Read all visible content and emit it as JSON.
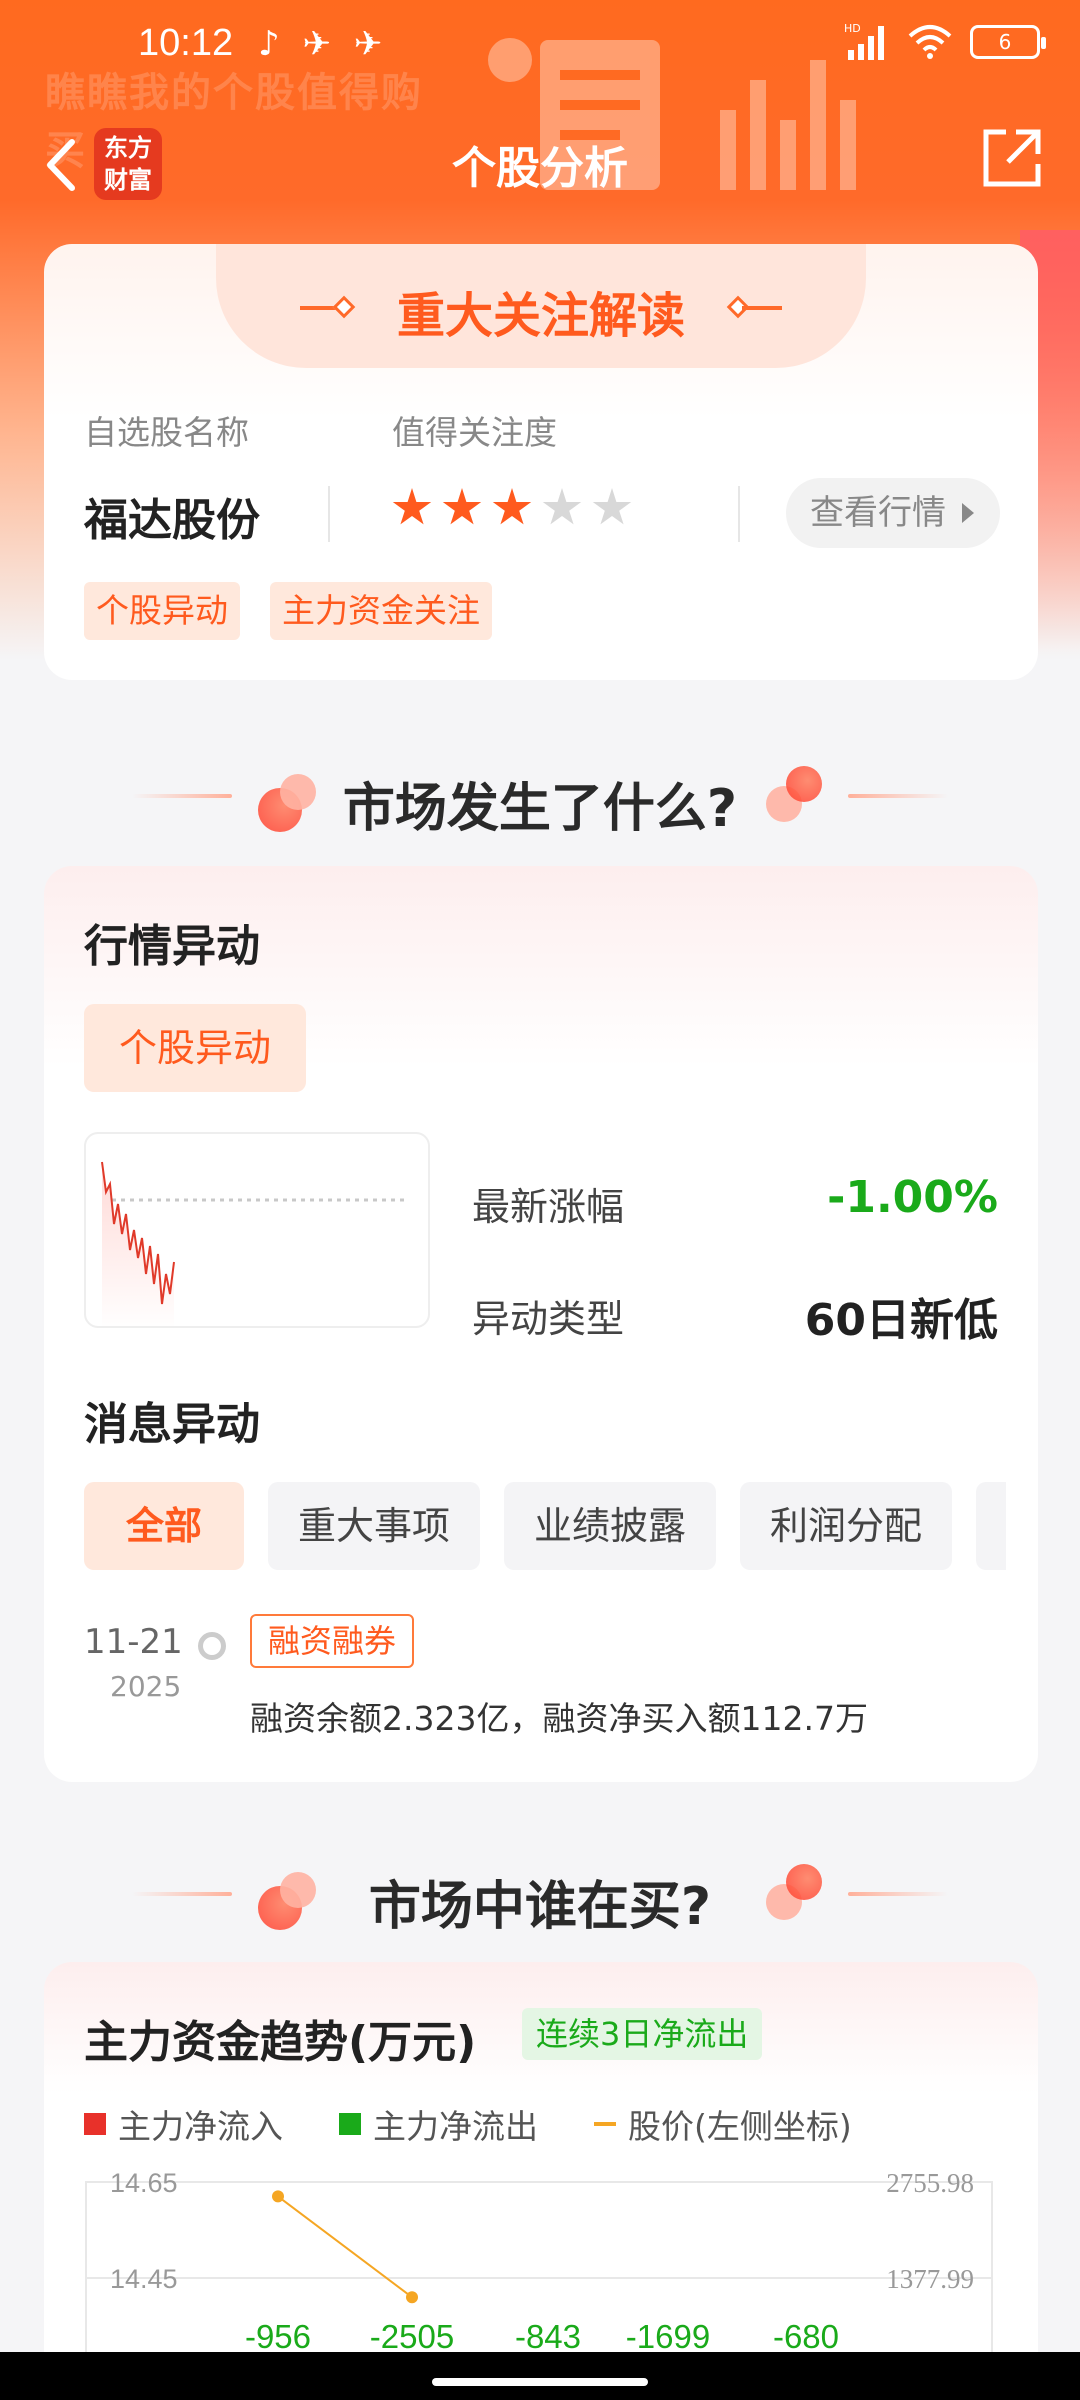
{
  "status_bar": {
    "time": "10:12",
    "hd": "HD",
    "battery": "6"
  },
  "banner": {
    "watermark_line1": "瞧瞧我的个股值得购",
    "watermark_line2": "买"
  },
  "nav": {
    "logo_line1": "东方",
    "logo_line2": "财富",
    "title": "个股分析"
  },
  "focus_card": {
    "title": "重大关注解读",
    "name_label": "自选股名称",
    "attention_label": "值得关注度",
    "stock_name": "福达股份",
    "rating": {
      "value": 3,
      "max": 5
    },
    "view_button": "查看行情",
    "tags": [
      "个股异动",
      "主力资金关注"
    ]
  },
  "section1": {
    "title": "市场发生了什么?"
  },
  "market_card": {
    "heading": "行情异动",
    "pill": "个股异动",
    "latest_change_label": "最新涨幅",
    "latest_change_value": "-1.00%",
    "type_label": "异动类型",
    "type_value": "60日新低",
    "news_heading": "消息异动",
    "filters": [
      "全部",
      "重大事项",
      "业绩披露",
      "利润分配"
    ],
    "news": [
      {
        "date": "11-21",
        "year": "2025",
        "tag": "融资融券",
        "text": "融资余额2.323亿，融资净买入额112.7万"
      }
    ]
  },
  "section2": {
    "title": "市场中谁在买?"
  },
  "fund_card": {
    "title": "主力资金趋势(万元)",
    "badge": "连续3日净流出",
    "legend": [
      {
        "label": "主力净流入",
        "color": "#e8312a"
      },
      {
        "label": "主力净流出",
        "color": "#1aaa1a"
      },
      {
        "label": "股价(左侧坐标)",
        "color": "#f5a623"
      }
    ]
  },
  "chart_data": {
    "type": "bar",
    "left_axis_ticks": [
      "14.65",
      "14.45"
    ],
    "right_axis_ticks": [
      "2755.98",
      "1377.99"
    ],
    "net_flow_labels": [
      "-956",
      "-2505",
      "-843",
      "-1699",
      "-680"
    ],
    "price_points_visible": [
      14.62,
      14.41
    ]
  }
}
